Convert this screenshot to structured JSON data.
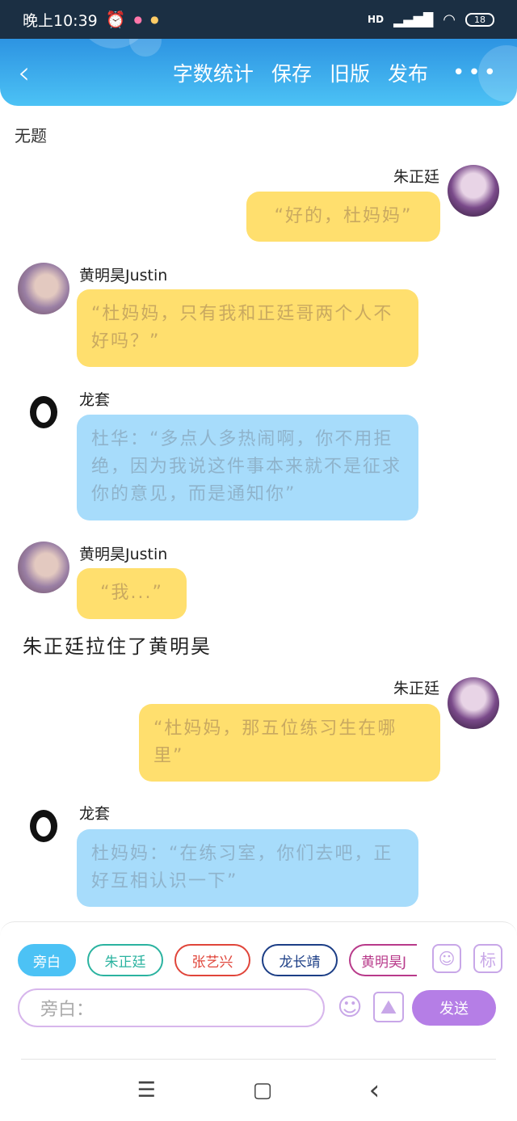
{
  "status_bar": {
    "time": "晚上10:39",
    "network": "HD",
    "battery": "18"
  },
  "header": {
    "actions": [
      "字数统计",
      "保存",
      "旧版",
      "发布"
    ]
  },
  "doc_title": "无题",
  "messages": [
    {
      "speaker": "朱正廷",
      "side": "right",
      "color": "yellow",
      "text": "“好的，杜妈妈”"
    },
    {
      "speaker": "黄明昊Justin",
      "side": "left",
      "color": "yellow",
      "text": "“杜妈妈，只有我和正廷哥两个人不好吗？”"
    },
    {
      "speaker": "龙套",
      "side": "left",
      "color": "blue",
      "text": "杜华：“多点人多热闹啊，你不用拒绝，因为我说这件事本来就不是征求你的意见，而是通知你”"
    },
    {
      "speaker": "黄明昊Justin",
      "side": "left",
      "color": "yellow",
      "text": "“我...”"
    },
    {
      "speaker": "朱正廷",
      "side": "right",
      "color": "yellow",
      "text": "“杜妈妈，那五位练习生在哪里”"
    },
    {
      "speaker": "龙套",
      "side": "left",
      "color": "blue",
      "text": "杜妈妈：“在练习室，你们去吧，正好互相认识一下”"
    }
  ],
  "narration": "朱正廷拉住了黄明昊",
  "composer": {
    "chips": [
      {
        "label": "旁白",
        "color": "#4cc2f5",
        "active": true
      },
      {
        "label": "朱正廷",
        "color": "#2bb3a0",
        "active": false
      },
      {
        "label": "张艺兴",
        "color": "#e0453a",
        "active": false
      },
      {
        "label": "龙长靖",
        "color": "#1c3e86",
        "active": false
      },
      {
        "label": "黄明昊J",
        "color": "#b83a8a",
        "active": false
      }
    ],
    "input_placeholder": "旁白：",
    "send_label": "发送",
    "mark_label": "标"
  },
  "nav": {
    "menu": "☰",
    "home": "▢",
    "back": "‹"
  }
}
